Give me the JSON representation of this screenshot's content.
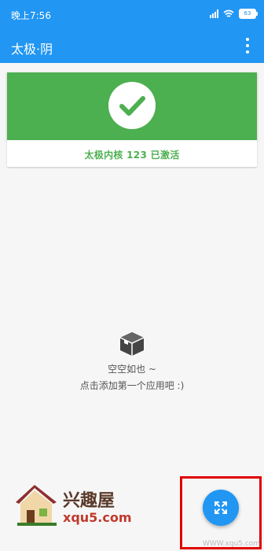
{
  "status_bar": {
    "time": "晚上7:56",
    "battery": "63"
  },
  "app_bar": {
    "title": "太极·阴"
  },
  "status_card": {
    "label": "太极内核 123 已激活"
  },
  "empty_state": {
    "line1": "空空如也 ~",
    "line2": "点击添加第一个应用吧 :)"
  },
  "watermark": {
    "brand": "兴趣屋",
    "domain": "xqu5.com",
    "corner": "WWW.xqu5.com"
  },
  "colors": {
    "primary": "#2196f3",
    "success": "#4caf50",
    "highlight": "#e00000"
  }
}
